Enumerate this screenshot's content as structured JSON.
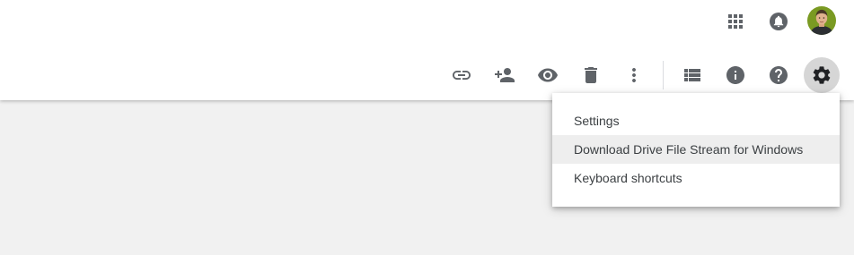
{
  "header": {
    "apps_icon": "apps-grid-icon",
    "notifications_icon": "bell-icon",
    "avatar_icon": "account-avatar"
  },
  "toolbar": {
    "actions": [
      {
        "name": "get-link-button",
        "icon": "link-icon"
      },
      {
        "name": "share-button",
        "icon": "person-add-icon"
      },
      {
        "name": "preview-button",
        "icon": "eye-icon"
      },
      {
        "name": "remove-button",
        "icon": "trash-icon"
      },
      {
        "name": "more-actions-button",
        "icon": "more-vert-icon"
      },
      {
        "name": "list-view-button",
        "icon": "list-view-icon"
      },
      {
        "name": "details-button",
        "icon": "info-icon"
      },
      {
        "name": "support-button",
        "icon": "help-icon"
      },
      {
        "name": "settings-button",
        "icon": "gear-icon",
        "active": true
      }
    ]
  },
  "settings_menu": {
    "items": [
      {
        "label": "Settings"
      },
      {
        "label": "Download Drive File Stream for Windows",
        "hovered": true
      },
      {
        "label": "Keyboard shortcuts"
      }
    ]
  },
  "colors": {
    "icon": "#5f6368",
    "active_icon_bg": "#d6d6d6",
    "page_bg": "#f1f1f1",
    "menu_hover_bg": "#eeeeee"
  }
}
